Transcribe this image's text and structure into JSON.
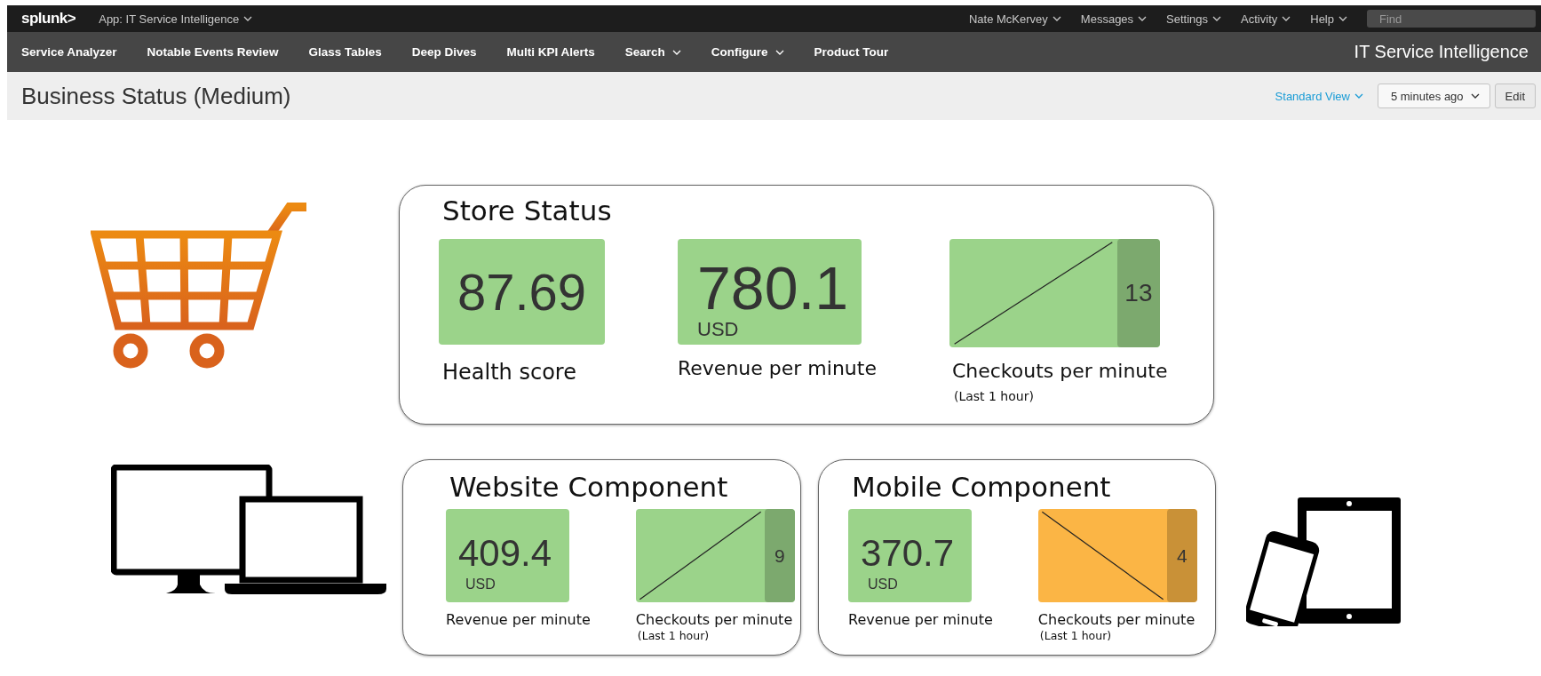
{
  "top_bar": {
    "logo": "splunk>",
    "app_menu": "App: IT Service Intelligence",
    "menus": [
      "Nate McKervey",
      "Messages",
      "Settings",
      "Activity",
      "Help"
    ],
    "search": {
      "placeholder": "Find"
    }
  },
  "nav_bar": {
    "items": [
      {
        "label": "Service Analyzer",
        "dropdown": false
      },
      {
        "label": "Notable Events Review",
        "dropdown": false
      },
      {
        "label": "Glass Tables",
        "dropdown": false
      },
      {
        "label": "Deep Dives",
        "dropdown": false
      },
      {
        "label": "Multi KPI Alerts",
        "dropdown": false
      },
      {
        "label": "Search",
        "dropdown": true
      },
      {
        "label": "Configure",
        "dropdown": true
      },
      {
        "label": "Product Tour",
        "dropdown": false
      }
    ],
    "app_title": "IT Service Intelligence"
  },
  "title_bar": {
    "title": "Business Status (Medium)",
    "view_menu": "Standard View",
    "time_picker": "5 minutes ago",
    "edit_button": "Edit"
  },
  "panels": [
    {
      "title": "Store Status",
      "tiles": [
        {
          "kind": "value",
          "value": "87.69",
          "label": "Health score",
          "color": "#9bd38a"
        },
        {
          "kind": "value",
          "value": "780.1",
          "unit": "USD",
          "label": "Revenue per minute",
          "color": "#9bd38a"
        },
        {
          "kind": "sparkline",
          "value": "13",
          "label": "Checkouts per minute",
          "sublabel": "(Last 1 hour)",
          "color": "#9bd38a"
        }
      ]
    },
    {
      "title": "Website Component",
      "tiles": [
        {
          "kind": "value",
          "value": "409.4",
          "unit": "USD",
          "label": "Revenue per minute",
          "color": "#9bd38a"
        },
        {
          "kind": "sparkline",
          "value": "9",
          "label": "Checkouts per minute",
          "sublabel": "(Last 1 hour)",
          "color": "#9bd38a"
        }
      ]
    },
    {
      "title": "Mobile Component",
      "tiles": [
        {
          "kind": "value",
          "value": "370.7",
          "unit": "USD",
          "label": "Revenue per minute",
          "color": "#9bd38a"
        },
        {
          "kind": "sparkline",
          "value": "4",
          "label": "Checkouts per minute",
          "sublabel": "(Last 1 hour)",
          "color": "#fbb545"
        }
      ]
    }
  ]
}
